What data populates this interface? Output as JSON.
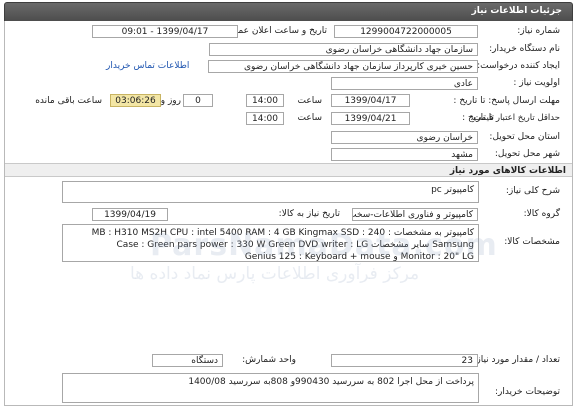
{
  "header": {
    "title": "جزئیات اطلاعات نیاز"
  },
  "fields": {
    "need_number_label": "شماره نیاز:",
    "need_number": "1299004722000005",
    "announce_label": "تاریخ و ساعت اعلان عمومی:",
    "announce_value": "1399/04/17 - 09:01",
    "buyer_org_label": "نام دستگاه خریدار:",
    "buyer_org": "سازمان جهاد دانشگاهی خراسان رضوی",
    "creator_label": "ایجاد کننده درخواست:",
    "creator": "حسین خیری کارپرداز سازمان جهاد دانشگاهی خراسان رضوی",
    "contact_link": "اطلاعات تماس خریدار",
    "priority_label": "اولویت نیاز :",
    "priority": "عادی",
    "deadline_label": "مهلت ارسال پاسخ: تا تاریخ :",
    "deadline_date": "1399/04/17",
    "time_label": "ساعت",
    "deadline_time": "14:00",
    "day_value": "0",
    "day_label": "روز و",
    "remaining_time": "03:06:26",
    "remaining_label": "ساعت باقی مانده",
    "validity_label": "حداقل تاریخ اعتبار قیمت:",
    "validity_prefix": "تا تاریخ :",
    "validity_date": "1399/04/21",
    "validity_time_label": "ساعت",
    "validity_time": "14:00",
    "province_label": "استان محل تحویل:",
    "province": "خراسان رضوی",
    "city_label": "شهر محل تحویل:",
    "city": "مشهد"
  },
  "goods": {
    "section_title": "اطلاعات کالاهای مورد نیاز",
    "summary_label": "شرح کلی نیاز:",
    "summary": "کامپیوتر pc",
    "group_label": "گروه کالا:",
    "group": "کامپیوتر و فناوری اطلاعات-سخت افزار",
    "need_date_label": "تاریخ نیاز به کالا:",
    "need_date": "1399/04/19",
    "specs_label": "مشخصات کالا:",
    "specs_line1": "کامپیوتر به مشخصات : MB : H310 MS2H  CPU : intel 5400   RAM : 4 GB Kingmax   SSD : 240",
    "specs_line2": "Samsung     سایر مشخصات Case : Green pars  power : 330 W Green  DVD writer : LG",
    "specs_line3": "Monitor : 20\" LG و Genius 125 : Keyboard + mouse",
    "qty_label": "تعداد / مقدار مورد نیاز:",
    "qty": "23",
    "unit_label": "واحد شمارش:",
    "unit": "دستگاه",
    "notes_label": "توضیحات خریدار:",
    "notes": "پرداخت از محل اجرا 802 به سررسید 990430و 808به سررسید 1400/08"
  },
  "watermark": {
    "line1": "ParsNamaData.com",
    "line2": "مرکز فرآوری اطلاعات پارس نماد داده ها"
  }
}
